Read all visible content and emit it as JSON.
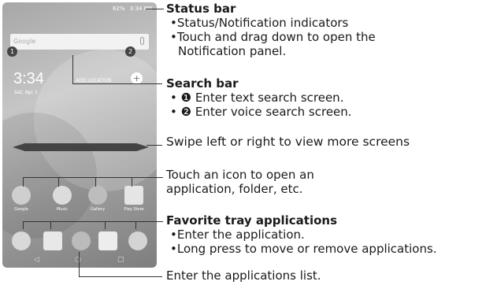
{
  "phone": {
    "status": {
      "battery": "62%",
      "time": "3:34 PM"
    },
    "search": {
      "placeholder": "Google",
      "badge1": "1",
      "badge2": "2"
    },
    "clock": {
      "time": "3:34",
      "date": "Sat, Apr 1",
      "add_location": "ADD LOCATION"
    },
    "apps": [
      {
        "label": "Google",
        "color": "#cfcfcf"
      },
      {
        "label": "Music",
        "color": "#dcdcdc"
      },
      {
        "label": "Gallery",
        "color": "#bdbdbd"
      },
      {
        "label": "Play Store",
        "color": "#e5e5e5"
      }
    ]
  },
  "callouts": {
    "status_bar": {
      "title": "Status bar",
      "line1": "•Status/Notification indicators",
      "line2": "•Touch and drag down to open the",
      "line3": "Notification panel."
    },
    "search_bar": {
      "title": "Search bar",
      "line1": "• ❶ Enter text search screen.",
      "line2": "• ❷ Enter voice search screen."
    },
    "swipe": "Swipe left or right to view more screens",
    "touch_icon": {
      "line1": "Touch an icon to open an",
      "line2": "application, folder, etc."
    },
    "favorites": {
      "title": "Favorite tray applications",
      "line1": "•Enter the application.",
      "line2": "•Long press to move or remove applications."
    },
    "apps_list": "Enter the applications list."
  }
}
